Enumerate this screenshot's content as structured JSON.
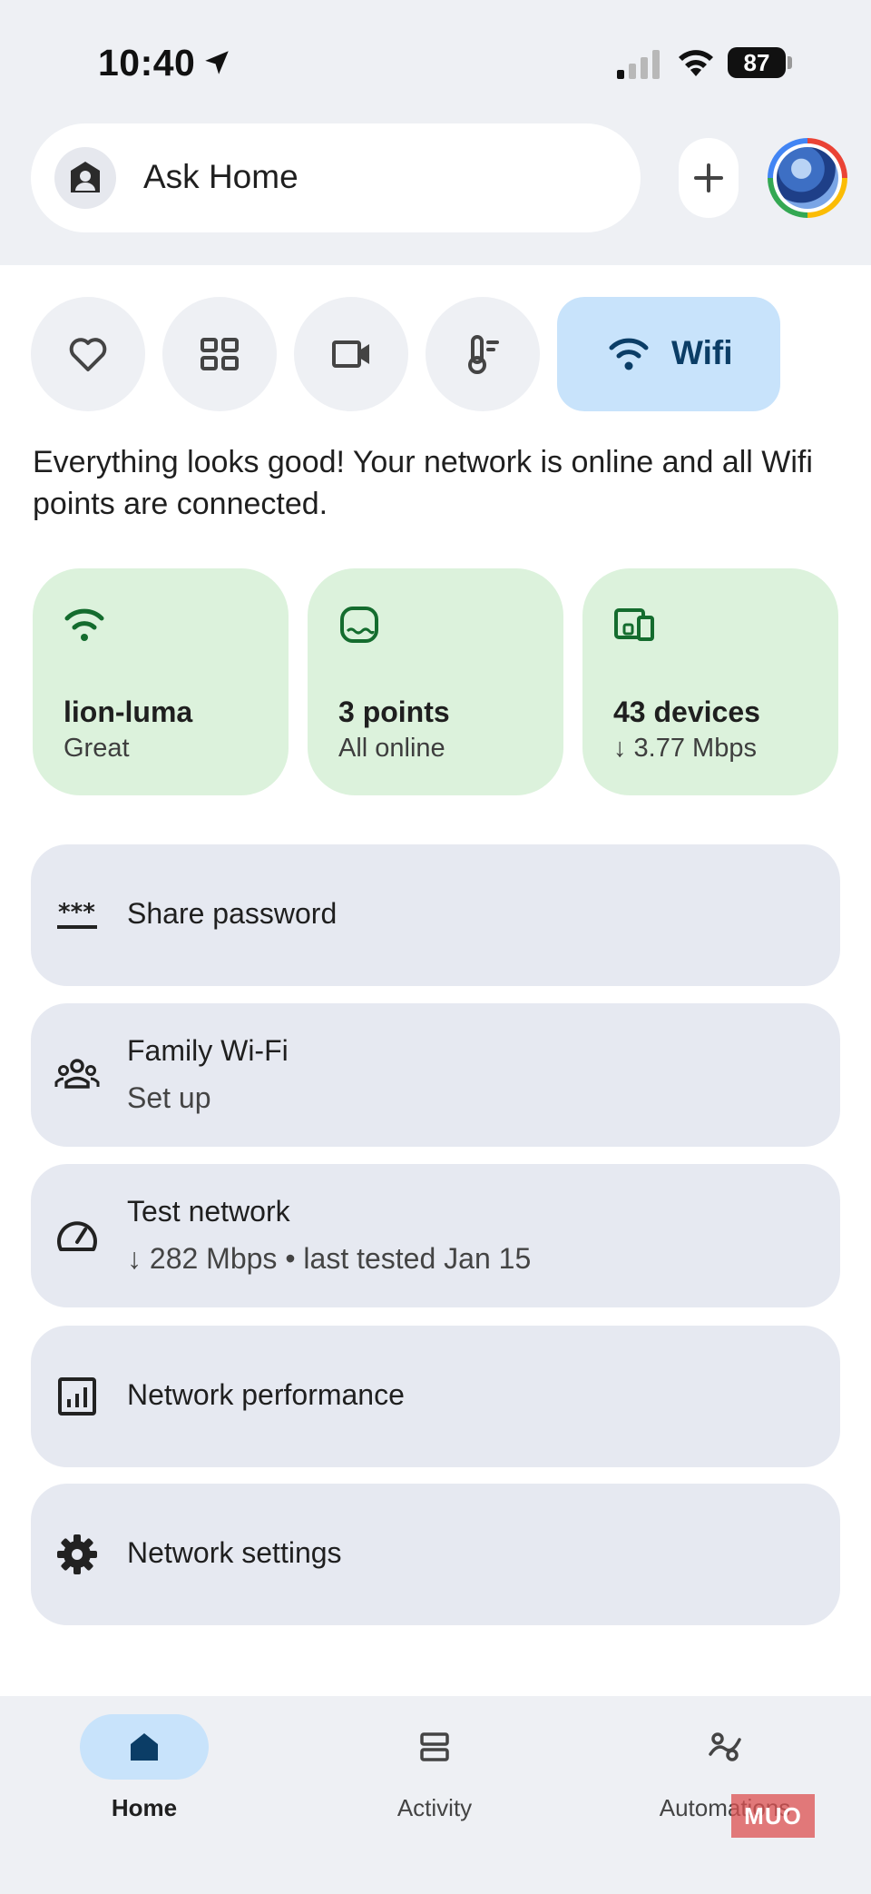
{
  "status_bar": {
    "time": "10:40",
    "battery": "87"
  },
  "search": {
    "placeholder": "Ask Home"
  },
  "categories": [
    {
      "name": "favorites",
      "icon": "heart-icon"
    },
    {
      "name": "devices",
      "icon": "grid-icon"
    },
    {
      "name": "cameras",
      "icon": "video-camera-icon"
    },
    {
      "name": "climate",
      "icon": "thermometer-icon"
    },
    {
      "name": "wifi",
      "icon": "wifi-icon",
      "label": "Wifi",
      "selected": true
    }
  ],
  "status_message": "Everything looks good! Your network is online and all Wifi points are connected.",
  "summary_cards": [
    {
      "icon": "wifi-icon",
      "title": "lion-luma",
      "subtitle": "Great"
    },
    {
      "icon": "router-icon",
      "title": "3 points",
      "subtitle": "All online"
    },
    {
      "icon": "devices-icon",
      "title": "43 devices",
      "subtitle": "↓ 3.77 Mbps"
    }
  ],
  "list_items": [
    {
      "icon": "password-icon",
      "label": "Share password"
    },
    {
      "icon": "family-icon",
      "label": "Family Wi-Fi",
      "subtitle": "Set up"
    },
    {
      "icon": "speedometer-icon",
      "label": "Test network",
      "subtitle": "↓ 282 Mbps • last tested Jan 15"
    },
    {
      "icon": "chart-icon",
      "label": "Network performance"
    },
    {
      "icon": "gear-icon",
      "label": "Network settings"
    }
  ],
  "bottom_nav": [
    {
      "label": "Home",
      "icon": "home-icon",
      "active": true
    },
    {
      "label": "Activity",
      "icon": "activity-icon"
    },
    {
      "label": "Automations",
      "icon": "automations-icon"
    }
  ],
  "watermark": "MUO",
  "colors": {
    "accent": "#c8e3fb",
    "card_green": "#dcf2dc",
    "icon_green": "#146c2e",
    "list_bg": "#e6e9f1"
  }
}
